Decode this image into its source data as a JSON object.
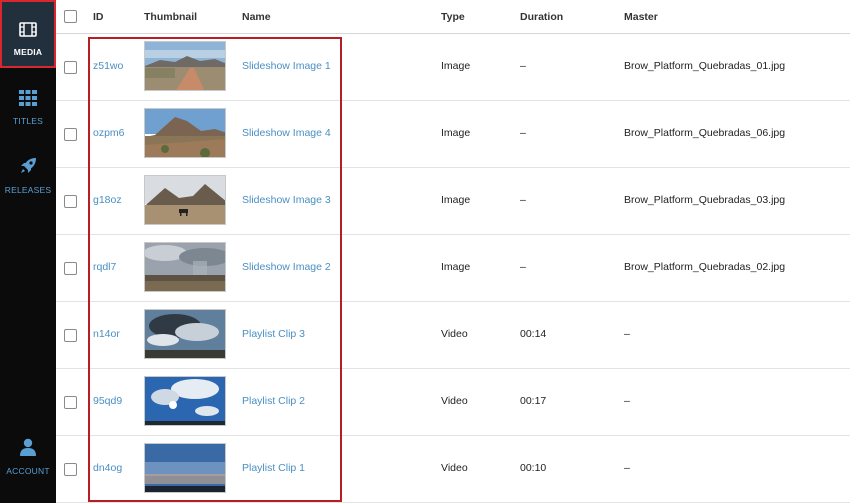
{
  "sidebar": {
    "items": [
      {
        "label": "MEDIA",
        "icon": "film-icon",
        "active": true
      },
      {
        "label": "TITLES",
        "icon": "grid-icon",
        "active": false
      },
      {
        "label": "RELEASES",
        "icon": "rocket-icon",
        "active": false
      },
      {
        "label": "ACCOUNT",
        "icon": "user-icon",
        "active": false
      }
    ]
  },
  "table": {
    "columns": [
      "ID",
      "Thumbnail",
      "Name",
      "Type",
      "Duration",
      "Master"
    ],
    "rows": [
      {
        "id": "z51wo",
        "name": "Slideshow Image 1",
        "type": "Image",
        "duration": "–",
        "master": "Brow_Platform_Quebradas_01.jpg"
      },
      {
        "id": "ozpm6",
        "name": "Slideshow Image 4",
        "type": "Image",
        "duration": "–",
        "master": "Brow_Platform_Quebradas_06.jpg"
      },
      {
        "id": "g18oz",
        "name": "Slideshow Image 3",
        "type": "Image",
        "duration": "–",
        "master": "Brow_Platform_Quebradas_03.jpg"
      },
      {
        "id": "rqdl7",
        "name": "Slideshow Image 2",
        "type": "Image",
        "duration": "–",
        "master": "Brow_Platform_Quebradas_02.jpg"
      },
      {
        "id": "n14or",
        "name": "Playlist Clip 3",
        "type": "Video",
        "duration": "00:14",
        "master": "–"
      },
      {
        "id": "95qd9",
        "name": "Playlist Clip 2",
        "type": "Video",
        "duration": "00:17",
        "master": "–"
      },
      {
        "id": "dn4og",
        "name": "Playlist Clip 1",
        "type": "Video",
        "duration": "00:10",
        "master": "–"
      }
    ]
  },
  "colors": {
    "sidebar_bg": "#0b0b0b",
    "active_bg": "#22303d",
    "link": "#4a8fc3",
    "highlight": "#b81c24"
  }
}
